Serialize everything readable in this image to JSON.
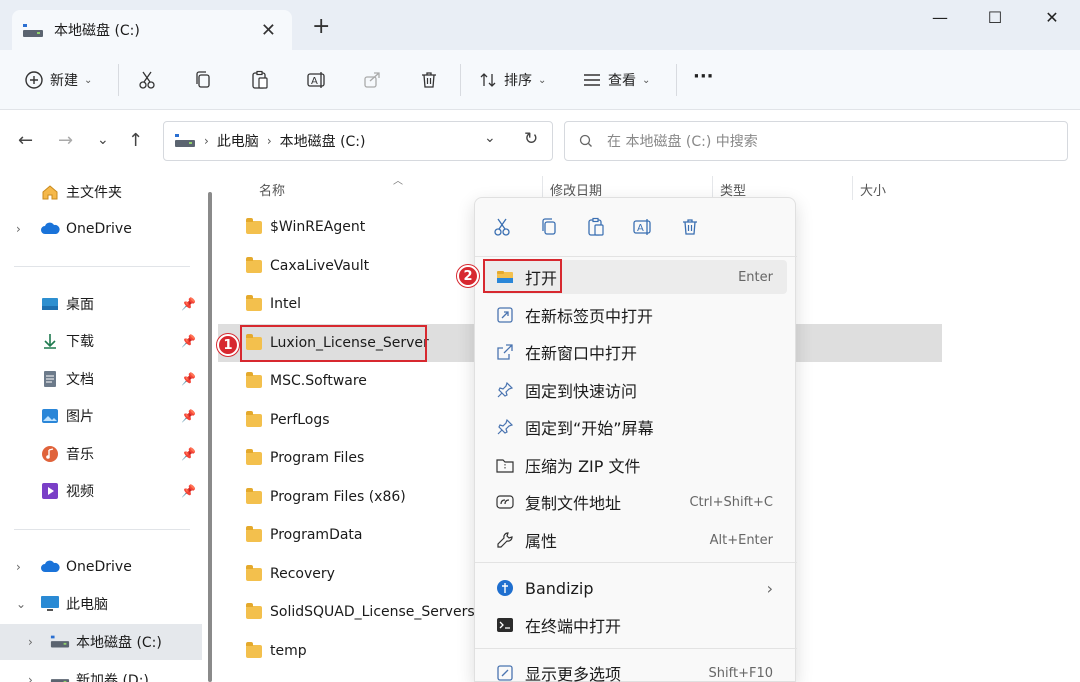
{
  "window": {
    "tab_title": "本地磁盘 (C:)",
    "tab_close": "✕",
    "tab_add": "+",
    "minimize": "—",
    "maximize": "☐",
    "close": "✕"
  },
  "toolbar": {
    "new_label": "新建",
    "sort_label": "排序",
    "view_label": "查看",
    "more_label": "···"
  },
  "nav": {
    "breadcrumb": [
      "此电脑",
      "本地磁盘 (C:)"
    ],
    "search_placeholder": "在 本地磁盘 (C:) 中搜索"
  },
  "sidebar": {
    "items": [
      {
        "label": "主文件夹",
        "icon": "home-icon"
      },
      {
        "label": "OneDrive",
        "icon": "cloud-icon"
      },
      {
        "label": "桌面",
        "icon": "desktop-icon",
        "pinned": true
      },
      {
        "label": "下载",
        "icon": "download-icon",
        "pinned": true
      },
      {
        "label": "文档",
        "icon": "document-icon",
        "pinned": true
      },
      {
        "label": "图片",
        "icon": "picture-icon",
        "pinned": true
      },
      {
        "label": "音乐",
        "icon": "music-icon",
        "pinned": true
      },
      {
        "label": "视频",
        "icon": "video-icon",
        "pinned": true
      },
      {
        "label": "OneDrive",
        "icon": "cloud-icon"
      },
      {
        "label": "此电脑",
        "icon": "pc-icon"
      },
      {
        "label": "本地磁盘 (C:)",
        "icon": "drive-icon",
        "selected": true
      },
      {
        "label": "新加卷 (D:)",
        "icon": "drive-icon"
      }
    ]
  },
  "columns": [
    "名称",
    "修改日期",
    "类型",
    "大小"
  ],
  "files": [
    "$WinREAgent",
    "CaxaLiveVault",
    "Intel",
    "Luxion_License_Server",
    "MSC.Software",
    "PerfLogs",
    "Program Files",
    "Program Files (x86)",
    "ProgramData",
    "Recovery",
    "SolidSQUAD_License_Servers",
    "temp"
  ],
  "annotations": {
    "step1": "1",
    "step2": "2"
  },
  "context_menu": {
    "items": [
      {
        "label": "打开",
        "shortcut": "Enter",
        "icon": "folder-open-icon"
      },
      {
        "label": "在新标签页中打开",
        "shortcut": "",
        "icon": "new-tab-icon"
      },
      {
        "label": "在新窗口中打开",
        "shortcut": "",
        "icon": "new-window-icon"
      },
      {
        "label": "固定到快速访问",
        "shortcut": "",
        "icon": "pin-icon"
      },
      {
        "label": "固定到“开始”屏幕",
        "shortcut": "",
        "icon": "pin-start-icon"
      },
      {
        "label": "压缩为 ZIP 文件",
        "shortcut": "",
        "icon": "zip-icon"
      },
      {
        "label": "复制文件地址",
        "shortcut": "Ctrl+Shift+C",
        "icon": "copy-path-icon"
      },
      {
        "label": "属性",
        "shortcut": "Alt+Enter",
        "icon": "properties-icon"
      },
      {
        "label": "Bandizip",
        "shortcut": "",
        "icon": "bandizip-icon"
      },
      {
        "label": "在终端中打开",
        "shortcut": "",
        "icon": "terminal-icon"
      },
      {
        "label": "显示更多选项",
        "shortcut": "Shift+F10",
        "icon": "more-options-icon"
      }
    ]
  }
}
